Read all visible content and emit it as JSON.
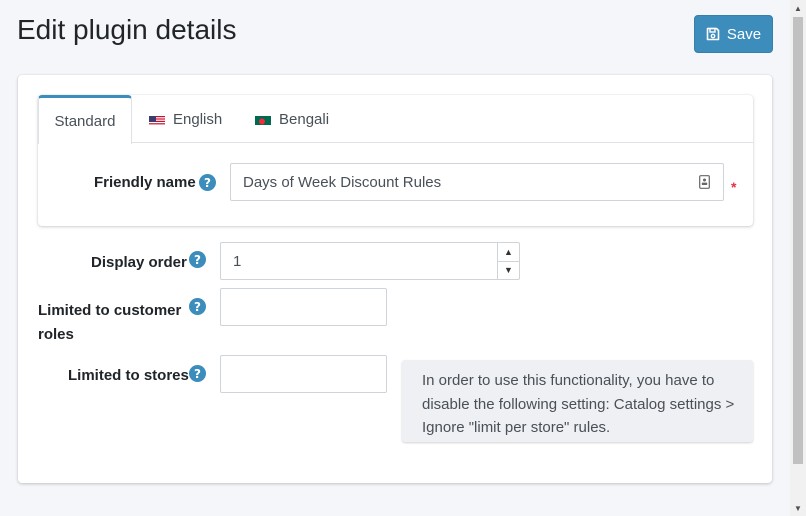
{
  "header": {
    "title": "Edit plugin details",
    "save_label": "Save"
  },
  "tabs": [
    {
      "label": "Standard",
      "active": true
    },
    {
      "label": "English",
      "flag": "us-flag-icon"
    },
    {
      "label": "Bengali",
      "flag": "bd-flag-icon"
    }
  ],
  "fields": {
    "friendly_name": {
      "label": "Friendly name",
      "value": "Days of Week Discount Rules",
      "required_mark": "*"
    },
    "display_order": {
      "label": "Display order",
      "value": "1"
    },
    "customer_roles": {
      "label_line1": "Limited to customer",
      "label_line2": "roles",
      "value": ""
    },
    "stores": {
      "label": "Limited to stores",
      "value": ""
    }
  },
  "help_glyph": "?",
  "spinner": {
    "up": "▲",
    "down": "▼"
  },
  "notice": {
    "line1": "In order to use this functionality, you have to",
    "line2": "disable the following setting: Catalog settings >",
    "line3": "Ignore \"limit per store\" rules."
  },
  "colors": {
    "accent": "#3c8dbc",
    "required": "#dc3545",
    "background": "#f4f6f9"
  }
}
